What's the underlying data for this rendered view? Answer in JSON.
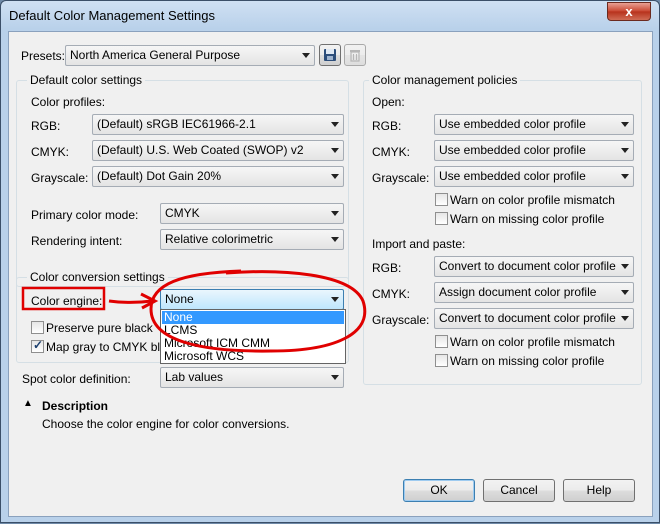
{
  "window": {
    "title": "Default Color Management Settings",
    "close_glyph": "x"
  },
  "presets": {
    "label": "Presets:",
    "value": "North America General Purpose",
    "save_icon": "save-icon",
    "delete_icon": "trash-icon"
  },
  "default_color_settings": {
    "title": "Default color settings",
    "profiles_label": "Color profiles:",
    "rgb_label": "RGB:",
    "rgb_value": "(Default) sRGB IEC61966-2.1",
    "cmyk_label": "CMYK:",
    "cmyk_value": "(Default) U.S. Web Coated (SWOP) v2",
    "gray_label": "Grayscale:",
    "gray_value": "(Default) Dot Gain 20%",
    "primary_label": "Primary color mode:",
    "primary_value": "CMYK",
    "intent_label": "Rendering intent:",
    "intent_value": "Relative colorimetric"
  },
  "conversion": {
    "title": "Color conversion settings",
    "engine_label": "Color engine:",
    "engine_value": "None",
    "engine_options": [
      "None",
      "LCMS",
      "Microsoft ICM CMM",
      "Microsoft WCS"
    ],
    "preserve_black_label": "Preserve pure black",
    "preserve_black_checked": false,
    "map_gray_label": "Map gray to CMYK black",
    "map_gray_checked": true
  },
  "spot": {
    "label": "Spot color definition:",
    "value": "Lab values"
  },
  "policies": {
    "title": "Color management policies",
    "open_label": "Open:",
    "rgb_label": "RGB:",
    "rgb_value": "Use embedded color profile",
    "cmyk_label": "CMYK:",
    "cmyk_value": "Use embedded color profile",
    "gray_label": "Grayscale:",
    "gray_value": "Use embedded color profile",
    "warn_mismatch_label": "Warn on color profile mismatch",
    "warn_missing_label": "Warn on missing color profile",
    "import_label": "Import and paste:",
    "imp_rgb_label": "RGB:",
    "imp_rgb_value": "Convert to document color profile",
    "imp_cmyk_label": "CMYK:",
    "imp_cmyk_value": "Assign document color profile",
    "imp_gray_label": "Grayscale:",
    "imp_gray_value": "Convert to document color profile",
    "imp_warn_mismatch_label": "Warn on color profile mismatch",
    "imp_warn_missing_label": "Warn on missing color profile"
  },
  "description": {
    "title": "Description",
    "text": "Choose the color engine for color conversions."
  },
  "buttons": {
    "ok": "OK",
    "cancel": "Cancel",
    "help": "Help"
  },
  "annotation_color": "#e00000"
}
